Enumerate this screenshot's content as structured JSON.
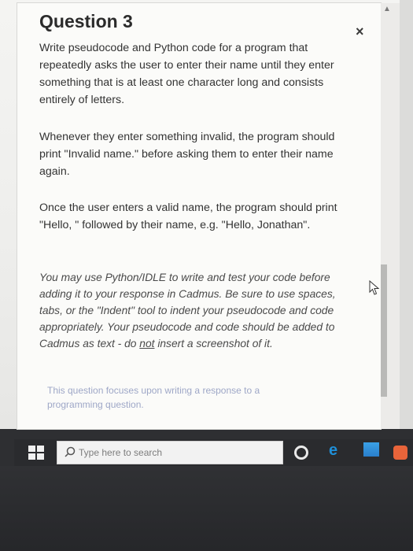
{
  "question": {
    "title": "Question 3",
    "paragraph_1": "Write pseudocode and Python code for a program that repeatedly asks the user to enter their name until they enter something that is at least one character long and consists entirely of letters.",
    "paragraph_2": "Whenever they enter something invalid, the program should print \"Invalid name.\" before asking them to enter their name again.",
    "paragraph_3": "Once the user enters a valid name, the program should print \"Hello, \" followed by their name, e.g. \"Hello, Jonathan\".",
    "paragraph_4_before": "You may use Python/IDLE to write and test your code before adding it to your response in Cadmus. Be sure to use spaces, tabs, or the \"Indent\" tool to indent your pseudocode and code appropriately. Your pseudocode and code should be added to Cadmus as text - do ",
    "paragraph_4_underlined": "not",
    "paragraph_4_after": " insert a screenshot of it.",
    "note": "This question focuses upon writing a response to a programming question."
  },
  "dialog": {
    "close_label": "×"
  },
  "taskbar": {
    "search_placeholder": "Type here to search",
    "icons": [
      "windows-start-icon",
      "search-icon",
      "cortana-icon",
      "edge-icon",
      "store-icon",
      "app-icon"
    ]
  },
  "colors": {
    "note_text": "#9ea7c7",
    "edge_blue": "#1f8fd8",
    "taskbar_bg": "#2a2b2e"
  }
}
